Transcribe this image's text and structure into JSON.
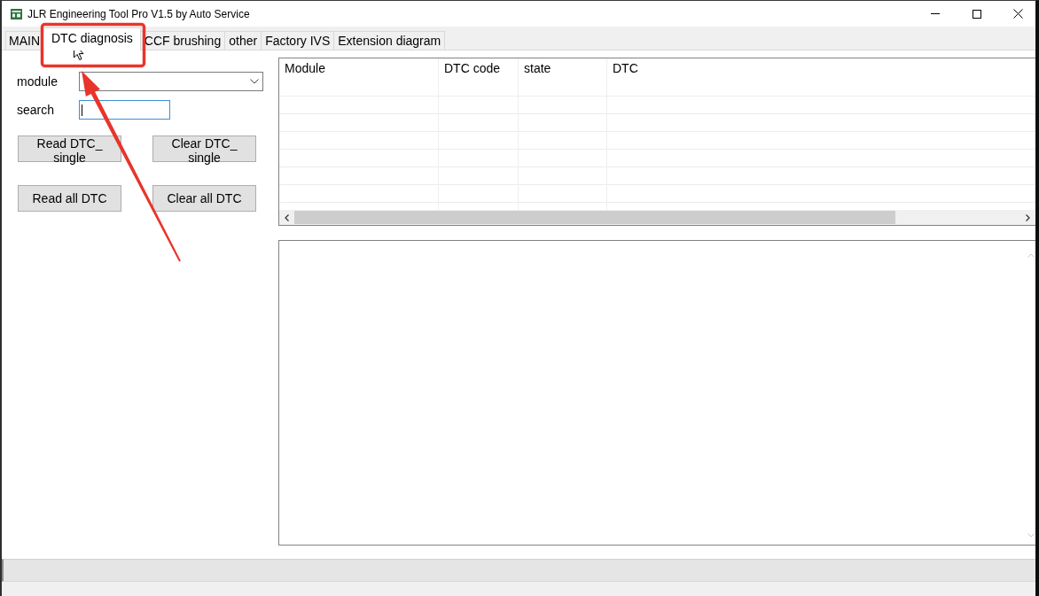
{
  "window": {
    "title": "JLR Engineering Tool Pro V1.5 by Auto Service"
  },
  "tabs": [
    {
      "label": "MAIN",
      "selected": false
    },
    {
      "label": "DTC diagnosis",
      "selected": true
    },
    {
      "label": "CCF brushing",
      "selected": false
    },
    {
      "label": "other",
      "selected": false
    },
    {
      "label": "Factory IVS",
      "selected": false
    },
    {
      "label": "Extension diagram",
      "selected": false
    }
  ],
  "dtc_panel": {
    "module": {
      "label": "module"
    },
    "search": {
      "label": "search",
      "focused": true
    },
    "buttons": [
      "Read DTC_ single",
      "Clear DTC_ single",
      "Read all DTC",
      "Clear all DTC"
    ]
  },
  "table": {
    "columns": [
      "Module",
      "DTC code",
      "state",
      "DTC"
    ]
  }
}
